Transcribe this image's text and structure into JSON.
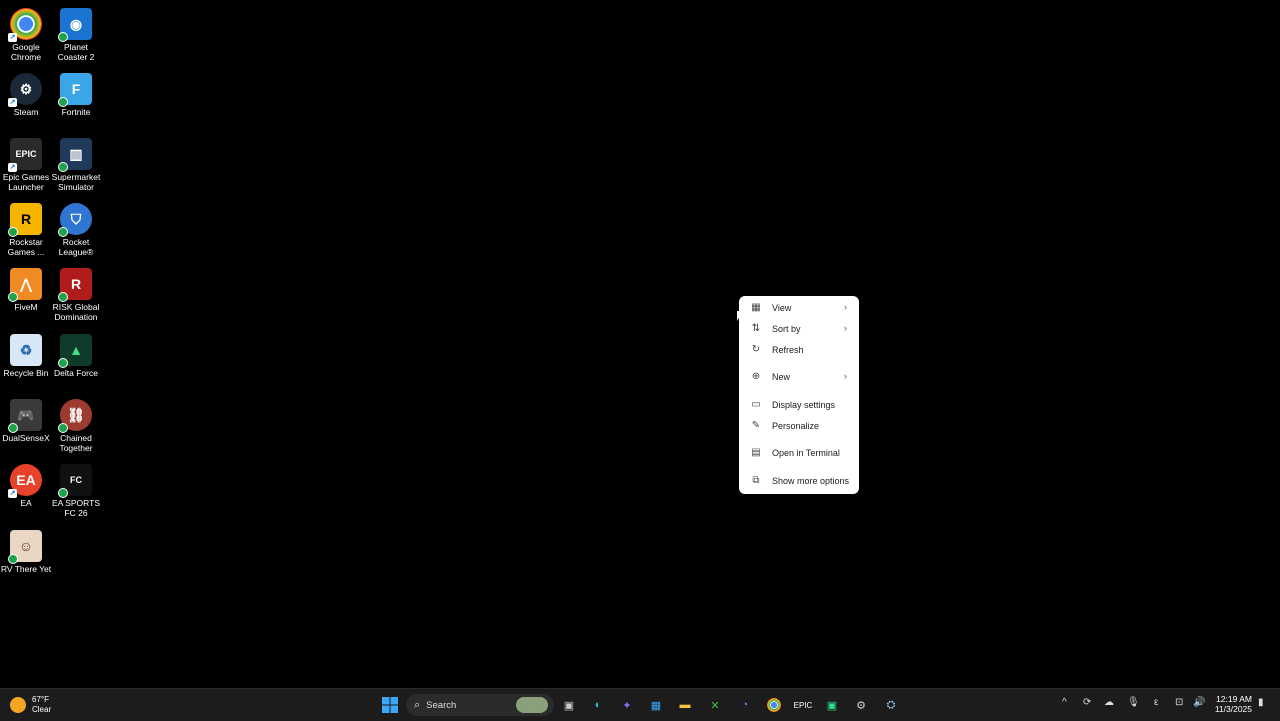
{
  "desktop_icons": [
    {
      "label": "Google Chrome",
      "icon": "chrome-icon",
      "color": "#ea4335"
    },
    {
      "label": "Planet Coaster 2",
      "icon": "planet-coaster-icon",
      "color": "#1b74d1"
    },
    {
      "label": "Steam",
      "icon": "steam-icon",
      "color": "#1b2838"
    },
    {
      "label": "Fortnite",
      "icon": "fortnite-icon",
      "color": "#3aa6e8"
    },
    {
      "label": "Epic Games Launcher",
      "icon": "epic-games-icon",
      "color": "#2a2a2a"
    },
    {
      "label": "Supermarket Simulator",
      "icon": "supermarket-icon",
      "color": "#203a5c"
    },
    {
      "label": "Rockstar Games ...",
      "icon": "rockstar-icon",
      "color": "#f5b400"
    },
    {
      "label": "Rocket League®",
      "icon": "rocket-league-icon",
      "color": "#2f76d2"
    },
    {
      "label": "FiveM",
      "icon": "fivem-icon",
      "color": "#f08a24"
    },
    {
      "label": "RISK Global Domination",
      "icon": "risk-icon",
      "color": "#b01c1c"
    },
    {
      "label": "Recycle Bin",
      "icon": "recycle-bin-icon",
      "color": "#7fb5e6"
    },
    {
      "label": "Delta Force",
      "icon": "delta-force-icon",
      "color": "#1faa6a"
    },
    {
      "label": "DualSenseX",
      "icon": "dualsensex-icon",
      "color": "#444444"
    },
    {
      "label": "Chained Together",
      "icon": "chained-together-icon",
      "color": "#9c3b2f"
    },
    {
      "label": "EA",
      "icon": "ea-icon",
      "color": "#e8432a"
    },
    {
      "label": "EA SPORTS FC 26",
      "icon": "ea-fc-icon",
      "color": "#111111"
    },
    {
      "label": "RV There Yet",
      "icon": "rv-there-yet-icon",
      "color": "#b07a5a"
    }
  ],
  "context_menu": {
    "items": [
      {
        "label": "View",
        "icon": "view-grid-icon",
        "has_submenu": true
      },
      {
        "label": "Sort by",
        "icon": "sort-icon",
        "has_submenu": true
      },
      {
        "label": "Refresh",
        "icon": "refresh-icon",
        "has_submenu": false
      },
      {
        "label": "New",
        "icon": "new-plus-icon",
        "has_submenu": true
      },
      {
        "label": "Display settings",
        "icon": "display-icon",
        "has_submenu": false
      },
      {
        "label": "Personalize",
        "icon": "brush-icon",
        "has_submenu": false
      },
      {
        "label": "Open in Terminal",
        "icon": "terminal-icon",
        "has_submenu": false
      },
      {
        "label": "Show more options",
        "icon": "more-options-icon",
        "has_submenu": false
      }
    ]
  },
  "taskbar": {
    "weather": {
      "temp": "67°F",
      "condition": "Clear"
    },
    "search_label": "Search",
    "clock": {
      "time": "12:19 AM",
      "date": "11/3/2025"
    }
  }
}
